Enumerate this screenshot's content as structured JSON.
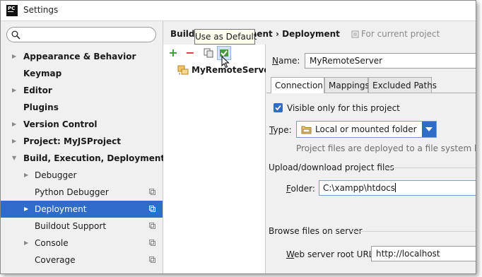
{
  "window": {
    "title": "Settings",
    "app_icon_text": "PC"
  },
  "search": {
    "value": ""
  },
  "tree": [
    {
      "label": "Appearance & Behavior",
      "bold": true,
      "arrow": "▶",
      "level": 0
    },
    {
      "label": "Keymap",
      "bold": true,
      "arrow": "",
      "level": 0
    },
    {
      "label": "Editor",
      "bold": true,
      "arrow": "▶",
      "level": 0
    },
    {
      "label": "Plugins",
      "bold": true,
      "arrow": "",
      "level": 0
    },
    {
      "label": "Version Control",
      "bold": true,
      "arrow": "▶",
      "level": 0
    },
    {
      "label": "Project: MyJSProject",
      "bold": true,
      "arrow": "▶",
      "level": 0
    },
    {
      "label": "Build, Execution, Deployment",
      "bold": true,
      "arrow": "▼",
      "level": 0
    },
    {
      "label": "Debugger",
      "bold": false,
      "arrow": "▶",
      "level": 1
    },
    {
      "label": "Python Debugger",
      "bold": false,
      "arrow": "",
      "level": 1,
      "copy": true
    },
    {
      "label": "Deployment",
      "bold": false,
      "arrow": "▶",
      "level": 1,
      "copy": true,
      "selected": true
    },
    {
      "label": "Buildout Support",
      "bold": false,
      "arrow": "",
      "level": 1,
      "copy": true
    },
    {
      "label": "Console",
      "bold": false,
      "arrow": "▶",
      "level": 1,
      "copy": true
    },
    {
      "label": "Coverage",
      "bold": false,
      "arrow": "",
      "level": 1,
      "copy": true
    }
  ],
  "breadcrumb": {
    "part1": "Build,",
    "part2": "ployment",
    "sep": "›",
    "part3": "Deployment"
  },
  "scope": {
    "text": "For current project"
  },
  "tooltip": {
    "text": "Use as Default"
  },
  "server_list": [
    {
      "label": "MyRemoteServer"
    }
  ],
  "form": {
    "name_label_u": "N",
    "name_label_rest": "ame:",
    "name_value": "MyRemoteServer",
    "tabs": [
      {
        "label": "Connection",
        "active": true
      },
      {
        "label": "Mappings",
        "active": false
      },
      {
        "label": "Excluded Paths",
        "active": false
      }
    ],
    "visible_only_label": "Visible only for this project",
    "visible_only_checked": true,
    "type_label_u": "T",
    "type_label_rest": "ype:",
    "type_value": "Local or mounted folder",
    "type_hint": "Project files are deployed to a file system location",
    "upload_section": "Upload/download project files",
    "folder_label_u": "F",
    "folder_label_rest": "older:",
    "folder_value": "C:\\xampp\\htdocs",
    "browse_section": "Browse files on server",
    "web_root_label_u": "W",
    "web_root_label_rest": "eb server root URL:",
    "web_root_value": "http://localhost"
  },
  "colors": {
    "selection": "#2f6bc9",
    "accent_add": "#3a9a3a",
    "accent_remove": "#dd3333"
  }
}
